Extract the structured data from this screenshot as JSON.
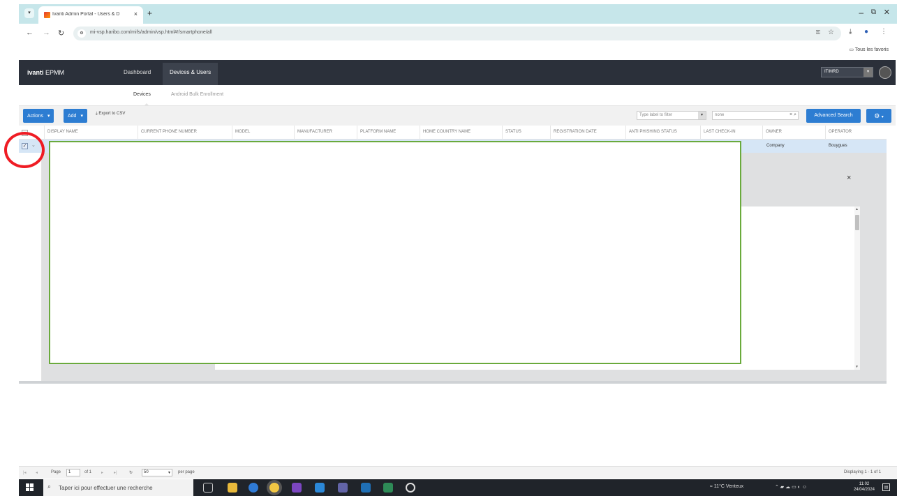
{
  "browser": {
    "tab_title": "Ivanti Admin Portal - Users & D",
    "tab_close": "×",
    "new_tab": "+",
    "url": "mi-vsp.haribo.com/mifs/admin/vsp.html#!/smartphone/all",
    "bookmarks_folder": "Tous les favoris",
    "window_controls": {
      "minimize": "–",
      "maximize": "⧉",
      "close": "✕"
    }
  },
  "app": {
    "logo_bold": "ivanti",
    "logo_light": " EPMM",
    "nav": [
      {
        "label": "Dashboard"
      },
      {
        "label": "Devices & Users"
      }
    ],
    "user": "ITIMRD"
  },
  "subnav": {
    "tabs": [
      {
        "label": "Devices"
      },
      {
        "label": "Android Bulk Enrollment"
      }
    ]
  },
  "toolbar": {
    "actions_label": "Actions",
    "add_label": "Add",
    "export_label": "Export to CSV",
    "filter_placeholder": "Type label to filter",
    "search_value": "none",
    "advanced_search_label": "Advanced Search"
  },
  "grid": {
    "columns": [
      "DISPLAY NAME",
      "CURRENT PHONE NUMBER",
      "MODEL",
      "MANUFACTURER",
      "PLATFORM NAME",
      "HOME COUNTRY NAME",
      "STATUS",
      "REGISTRATION DATE",
      "ANTI PHISHING STATUS",
      "LAST CHECK-IN",
      "OWNER",
      "OPERATOR"
    ],
    "row": {
      "checkbox": "✓",
      "owner": "Company",
      "operator": "Bouygues"
    }
  },
  "detail": {
    "close": "×"
  },
  "pager": {
    "page_label": "Page",
    "page_value": "1",
    "of_label": "of 1",
    "per_page_value": "50",
    "per_page_label": "per page",
    "displaying": "Displaying 1 - 1 of 1"
  },
  "taskbar": {
    "search_placeholder": "Taper ici pour effectuer une recherche",
    "weather": "11°C Venteux",
    "time": "11:02",
    "date": "24/04/2024"
  },
  "colors": {
    "accent": "#2d7dd2",
    "header_bg": "#2b303a",
    "annotation_green": "#6aaa3c",
    "annotation_red": "#ef1c24"
  }
}
